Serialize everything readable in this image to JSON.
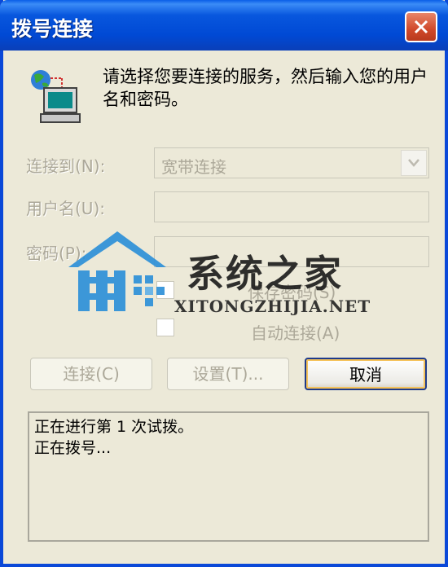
{
  "window": {
    "title": "拨号连接",
    "close_icon": "close-icon"
  },
  "intro": {
    "icon": "network-computer-icon",
    "text": "请选择您要连接的服务，然后输入您的用户名和密码。"
  },
  "form": {
    "connect_to_label": "连接到(N):",
    "connect_to_value": "宽带连接",
    "username_label": "用户名(U):",
    "username_value": "",
    "password_label": "密码(P):",
    "password_value": "",
    "save_password_label": "保存密码(S)",
    "auto_connect_label": "自动连接(A)"
  },
  "buttons": {
    "connect": "连接(C)",
    "settings": "设置(T)...",
    "cancel": "取消"
  },
  "status_log": {
    "lines": [
      "正在进行第 1 次试拨。",
      "正在拨号..."
    ]
  },
  "watermark": {
    "title": "系统之家",
    "subtitle": "XITONGZHIJIA.NET"
  },
  "colors": {
    "titlebar": "#0a5ee8",
    "close_button": "#d0482a",
    "dialog_background": "#ece9d8",
    "disabled_text": "#aca899",
    "watermark_blue": "#2a8fd8"
  }
}
